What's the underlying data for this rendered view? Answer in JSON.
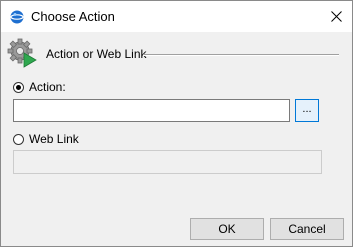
{
  "window": {
    "title": "Choose Action",
    "close_symbol": "✕"
  },
  "group": {
    "title": "Action or Web Link",
    "icon": "gear-play-icon"
  },
  "action": {
    "label": "Action:",
    "selected": true,
    "value": "",
    "browse_label": "..."
  },
  "weblink": {
    "label": "Web Link",
    "selected": false,
    "value": ""
  },
  "buttons": {
    "ok": "OK",
    "cancel": "Cancel"
  },
  "colors": {
    "accent": "#0078d7",
    "app_icon": "#1e6fd0",
    "gear": "#8a8a8a",
    "play": "#2fa84f"
  }
}
